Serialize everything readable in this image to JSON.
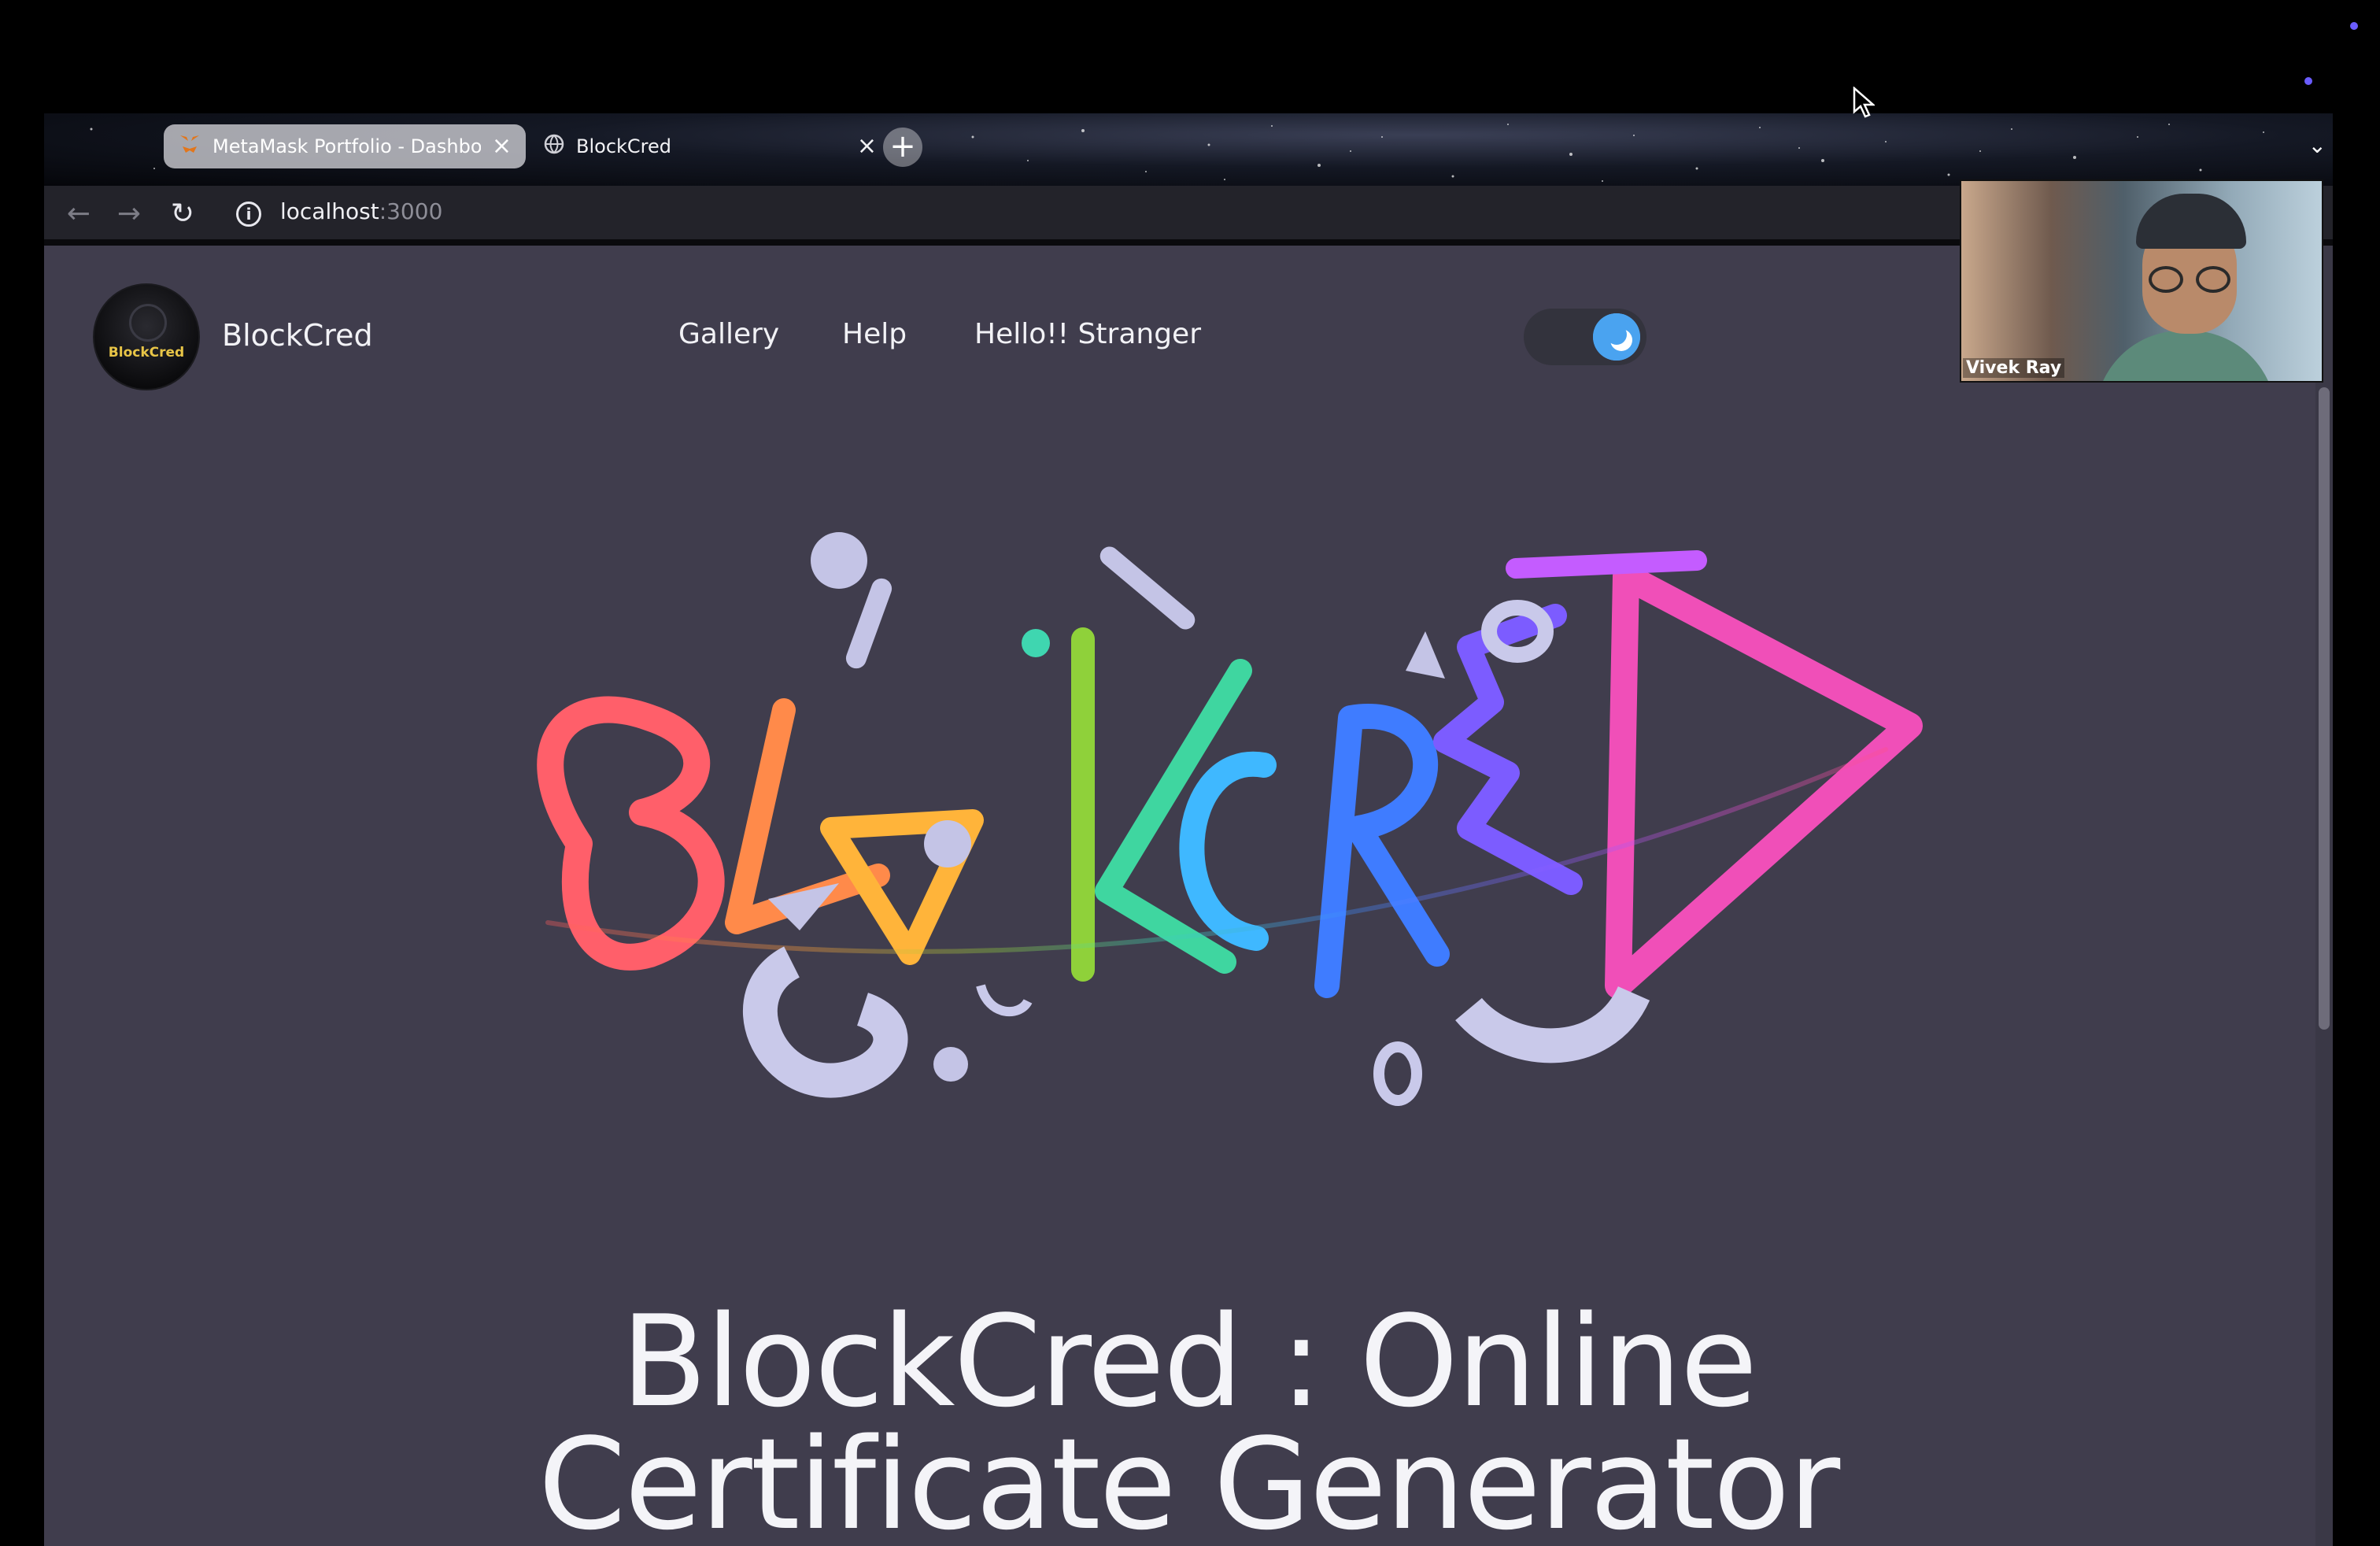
{
  "browser": {
    "tabs": [
      {
        "title": "MetaMask Portfolio - Dashboard",
        "icon": "fox-icon",
        "active": false
      },
      {
        "title": "BlockCred",
        "icon": "globe-icon",
        "active": true
      }
    ],
    "close_glyph": "×",
    "new_tab_glyph": "+",
    "tab_list_glyph": "⌄",
    "back_glyph": "←",
    "forward_glyph": "→",
    "reload_glyph": "↻",
    "info_glyph": "i",
    "address": {
      "host": "localhost",
      "port": ":3000"
    }
  },
  "header": {
    "logo_text": "BlockCred",
    "brand": "BlockCred",
    "nav": [
      "Gallery",
      "Help",
      "Hello!! Stranger"
    ],
    "theme_toggle": {
      "state": "dark",
      "icon": "moon-icon",
      "accent": "#4aa3f0"
    }
  },
  "hero": {
    "art": "BlockCred 3D graffiti lettering",
    "title_line1": "BlockCred : Online",
    "title_line2": "Certificate Generator"
  },
  "video_call": {
    "participant": "Vivek Ray"
  },
  "colors": {
    "page_bg": "#403d4d",
    "text": "#f2f2f6",
    "toolbar": "#23232a"
  }
}
